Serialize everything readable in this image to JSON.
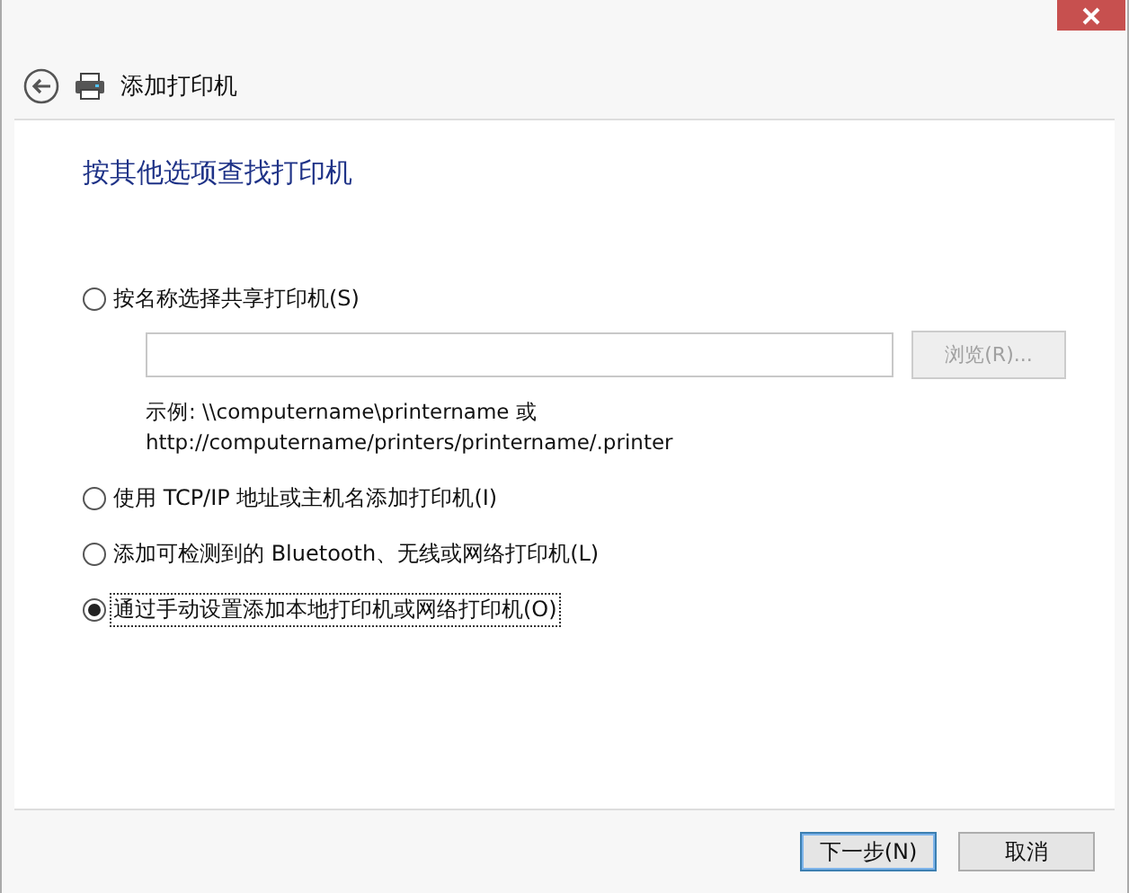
{
  "window": {
    "title": "添加打印机"
  },
  "heading": "按其他选项查找打印机",
  "options": [
    {
      "kind": "with-field",
      "label": "按名称选择共享打印机(S)",
      "selected": false,
      "browse": {
        "label": "浏览(R)...",
        "disabled": true
      },
      "example": [
        "示例: \\\\computername\\printername 或",
        "http://computername/printers/printername/.printer"
      ]
    },
    {
      "kind": "plain",
      "label": "使用 TCP/IP 地址或主机名添加打印机(I)",
      "selected": false
    },
    {
      "kind": "plain",
      "label": "添加可检测到的 Bluetooth、无线或网络打印机(L)",
      "selected": false
    },
    {
      "kind": "plain",
      "label": "通过手动设置添加本地打印机或网络打印机(O)",
      "selected": true
    }
  ],
  "buttons": [
    {
      "label": "下一步(N)",
      "default": true
    },
    {
      "label": "取消",
      "default": false
    }
  ]
}
